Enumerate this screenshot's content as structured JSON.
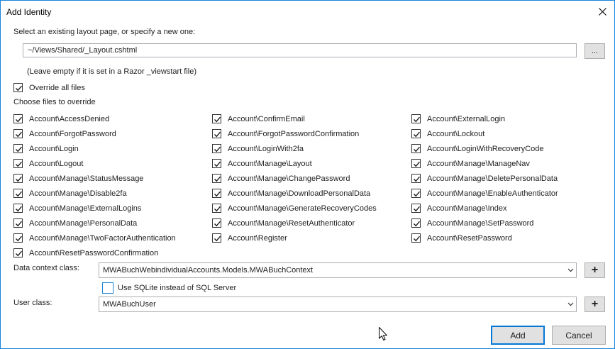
{
  "dialog": {
    "title": "Add Identity"
  },
  "layout": {
    "prompt": "Select an existing layout page, or specify a new one:",
    "path_value": "~/Views/Shared/_Layout.cshtml",
    "browse_label": "...",
    "hint": "(Leave empty if it is set in a Razor _viewstart file)"
  },
  "override_all": {
    "label": "Override all files",
    "checked": true
  },
  "choose_label": "Choose files to override",
  "files": [
    {
      "label": "Account\\AccessDenied",
      "checked": true
    },
    {
      "label": "Account\\ConfirmEmail",
      "checked": true
    },
    {
      "label": "Account\\ExternalLogin",
      "checked": true
    },
    {
      "label": "Account\\ForgotPassword",
      "checked": true
    },
    {
      "label": "Account\\ForgotPasswordConfirmation",
      "checked": true
    },
    {
      "label": "Account\\Lockout",
      "checked": true
    },
    {
      "label": "Account\\Login",
      "checked": true
    },
    {
      "label": "Account\\LoginWith2fa",
      "checked": true
    },
    {
      "label": "Account\\LoginWithRecoveryCode",
      "checked": true
    },
    {
      "label": "Account\\Logout",
      "checked": true
    },
    {
      "label": "Account\\Manage\\Layout",
      "checked": true
    },
    {
      "label": "Account\\Manage\\ManageNav",
      "checked": true
    },
    {
      "label": "Account\\Manage\\StatusMessage",
      "checked": true
    },
    {
      "label": "Account\\Manage\\ChangePassword",
      "checked": true
    },
    {
      "label": "Account\\Manage\\DeletePersonalData",
      "checked": true
    },
    {
      "label": "Account\\Manage\\Disable2fa",
      "checked": true
    },
    {
      "label": "Account\\Manage\\DownloadPersonalData",
      "checked": true
    },
    {
      "label": "Account\\Manage\\EnableAuthenticator",
      "checked": true
    },
    {
      "label": "Account\\Manage\\ExternalLogins",
      "checked": true
    },
    {
      "label": "Account\\Manage\\GenerateRecoveryCodes",
      "checked": true
    },
    {
      "label": "Account\\Manage\\Index",
      "checked": true
    },
    {
      "label": "Account\\Manage\\PersonalData",
      "checked": true
    },
    {
      "label": "Account\\Manage\\ResetAuthenticator",
      "checked": true
    },
    {
      "label": "Account\\Manage\\SetPassword",
      "checked": true
    },
    {
      "label": "Account\\Manage\\TwoFactorAuthentication",
      "checked": true
    },
    {
      "label": "Account\\Register",
      "checked": true
    },
    {
      "label": "Account\\ResetPassword",
      "checked": true
    },
    {
      "label": "Account\\ResetPasswordConfirmation",
      "checked": true
    }
  ],
  "data_context": {
    "label": "Data context class:",
    "value": "MWABuchWebindividualAccounts.Models.MWABuchContext",
    "add_label": "+"
  },
  "sqlite": {
    "label": "Use SQLite instead of SQL Server",
    "checked": false
  },
  "user_class": {
    "label": "User class:",
    "value": "MWABuchUser",
    "add_label": "+"
  },
  "buttons": {
    "add": "Add",
    "cancel": "Cancel"
  },
  "colors": {
    "accent": "#1883d7",
    "button_bg": "#e1e1e1"
  }
}
